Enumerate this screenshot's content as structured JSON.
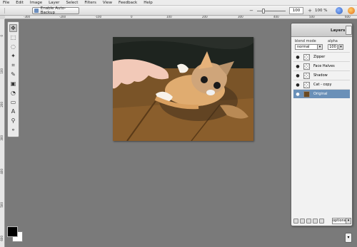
{
  "menu": [
    "File",
    "Edit",
    "Image",
    "Layer",
    "Select",
    "Filters",
    "View",
    "Feedback",
    "Help"
  ],
  "toolbar": {
    "backup_label": "Enable Auto-Backup",
    "zoom_value": "100",
    "zoom_percent": "100 %",
    "zoom_minus": "−",
    "zoom_plus": "+",
    "zoom_level": 0.35
  },
  "ruler_top": [
    "-300",
    "-200",
    "-100",
    "0",
    "100",
    "200",
    "300",
    "400",
    "500",
    "600",
    "700"
  ],
  "ruler_left": [
    "0",
    "100",
    "200",
    "300",
    "400",
    "500",
    "600"
  ],
  "tools": [
    {
      "icon": "move-icon",
      "glyph": "✥"
    },
    {
      "icon": "marquee-icon",
      "glyph": "⬚"
    },
    {
      "icon": "lasso-icon",
      "glyph": "◌"
    },
    {
      "icon": "wand-icon",
      "glyph": "✦"
    },
    {
      "icon": "crop-icon",
      "glyph": "⌗"
    },
    {
      "icon": "brush-icon",
      "glyph": "✎"
    },
    {
      "icon": "stamp-icon",
      "glyph": "▣"
    },
    {
      "icon": "fill-icon",
      "glyph": "◔"
    },
    {
      "icon": "eraser-icon",
      "glyph": "▭"
    },
    {
      "icon": "text-icon",
      "glyph": "A"
    },
    {
      "icon": "eyedropper-icon",
      "glyph": "⚲"
    },
    {
      "icon": "zoom-icon",
      "glyph": "⚬"
    }
  ],
  "layers_panel": {
    "title": "Layers",
    "blend_label": "blend mode",
    "alpha_label": "alpha",
    "blend_value": "normal",
    "alpha_value": "100",
    "options_label": "options",
    "layers": [
      {
        "name": "Zipper",
        "selected": false
      },
      {
        "name": "Face Halves",
        "selected": false
      },
      {
        "name": "Shadow",
        "selected": false
      },
      {
        "name": "Cat - copy",
        "selected": false
      },
      {
        "name": "Original",
        "selected": true
      }
    ]
  },
  "colors": {
    "foreground": "#000000",
    "background": "#ffffff",
    "selection": "#6a90b8"
  }
}
